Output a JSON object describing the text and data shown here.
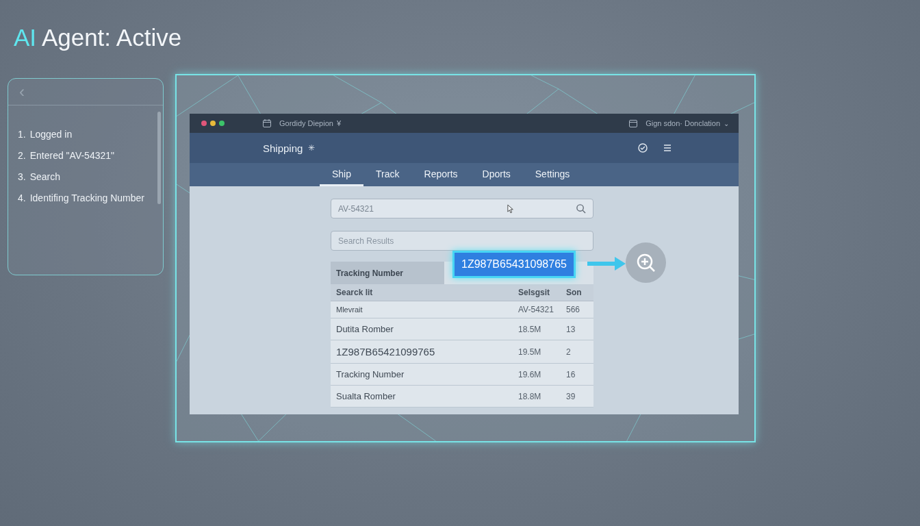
{
  "agent_title": {
    "highlight": "AI",
    "rest": "Agent: Active"
  },
  "steps_panel": {
    "back": "‹",
    "steps": [
      {
        "number": "1.",
        "text": "Logged in"
      },
      {
        "number": "2.",
        "text": "Entered \"AV-54321\""
      },
      {
        "number": "3.",
        "text": "Search"
      },
      {
        "number": "4.",
        "text": "Identifing Tracking Number"
      }
    ]
  },
  "window": {
    "title": "Gordidy Diepion",
    "title_mark": "¥",
    "account": "Gign sdon· Donclation",
    "account_caret": "⌄"
  },
  "header": {
    "title": "Shipping",
    "title_mark": "✳"
  },
  "tabs": [
    {
      "label": "Ship",
      "selected": true
    },
    {
      "label": "Track",
      "selected": false
    },
    {
      "label": "Reports",
      "selected": false
    },
    {
      "label": "Dports",
      "selected": false
    },
    {
      "label": "Settings",
      "selected": false
    }
  ],
  "search": {
    "value": "AV-54321"
  },
  "results": {
    "placeholder": "Search Results"
  },
  "table": {
    "title": "Tracking Number",
    "columns": [
      "Searck lit",
      "Selsgsit",
      "Son"
    ],
    "rows": [
      {
        "cells": [
          "Mlevrait",
          "AV-54321",
          "566"
        ],
        "kind": "compact"
      },
      {
        "cells": [
          "Dutita Romber",
          "18.5M",
          "13"
        ],
        "kind": "plain"
      },
      {
        "cells": [
          "1Z987B65421099765",
          "19.5M",
          "2"
        ],
        "kind": "emphasized"
      },
      {
        "cells": [
          "Tracking Number",
          "19.6M",
          "16"
        ],
        "kind": "plain"
      },
      {
        "cells": [
          "Sualta Romber",
          "18.8M",
          "39"
        ],
        "kind": "plain"
      }
    ]
  },
  "highlight": {
    "value": "1Z987B65431098765"
  }
}
